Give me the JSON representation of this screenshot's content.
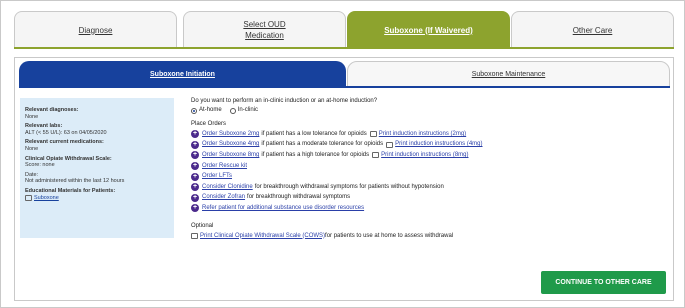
{
  "top_tabs": [
    {
      "label": "Diagnose"
    },
    {
      "label": "Select OUD\nMedication"
    },
    {
      "label": "Suboxone (If Waivered)"
    },
    {
      "label": "Other Care"
    }
  ],
  "sub_tabs": {
    "induction": "Suboxone Initiation",
    "maintenance": "Suboxone Maintenance"
  },
  "info": {
    "diagnoses_label": "Relevant diagnoses:",
    "diagnoses_value": "None",
    "labs_label": "Relevant labs:",
    "labs_value": "ALT (< 55 U/L): 63 on 04/05/2020",
    "medications_label": "Relevant current medications:",
    "medications_value": "None",
    "cows_label": "Clinical Opiate Withdrawal Scale:",
    "cows_value": "Score: none",
    "date_label": "Date:",
    "date_value": "Not administered within the last 12 hours",
    "materials_label": "Educational Materials for Patients:",
    "materials_link": "Suboxone"
  },
  "content": {
    "question": "Do you want to perform an in-clinic induction or an at-home induction?",
    "radio_home": "At-home",
    "radio_clinic": "In-clinic",
    "place_orders": "Place Orders",
    "orders": [
      {
        "link": "Order Suboxone 2mg",
        "text": " if patient has a low tolerance for opioids",
        "print": "Print induction instructions (2mg)"
      },
      {
        "link": "Order Suboxone 4mg",
        "text": " if patient has a moderate tolerance for opioids",
        "print": "Print induction instructions (4mg)"
      },
      {
        "link": "Order Suboxone 8mg",
        "text": " if patient has a high tolerance for opioids",
        "print": "Print induction instructions (8mg)"
      },
      {
        "link": "Order Rescue kit",
        "text": "",
        "print": ""
      },
      {
        "link": "Order LFTs",
        "text": "",
        "print": ""
      },
      {
        "link": "Consider Clonidine",
        "text": " for breakthrough withdrawal symptoms for patients without hypotension",
        "print": ""
      },
      {
        "link": "Consider Zofran",
        "text": " for breakthrough withdrawal symptoms",
        "print": ""
      },
      {
        "link": "Refer patient for additional substance use disorder resources",
        "text": "",
        "print": ""
      }
    ],
    "optional_title": "Optional",
    "optional_link": "Print Clinical Opiate Withdrawal Scale (COWS)",
    "optional_text": " for patients to use at home to assess withdrawal"
  },
  "cta_label": "CONTINUE TO OTHER CARE",
  "colors": {
    "tab_active": "#8da32e",
    "subtab_active": "#17419d",
    "cta": "#1f9a4a",
    "plus": "#4b2a8c",
    "info_bg": "#dcecf8"
  },
  "icons": {
    "order": "plus-circle-icon",
    "print": "printer-icon"
  }
}
